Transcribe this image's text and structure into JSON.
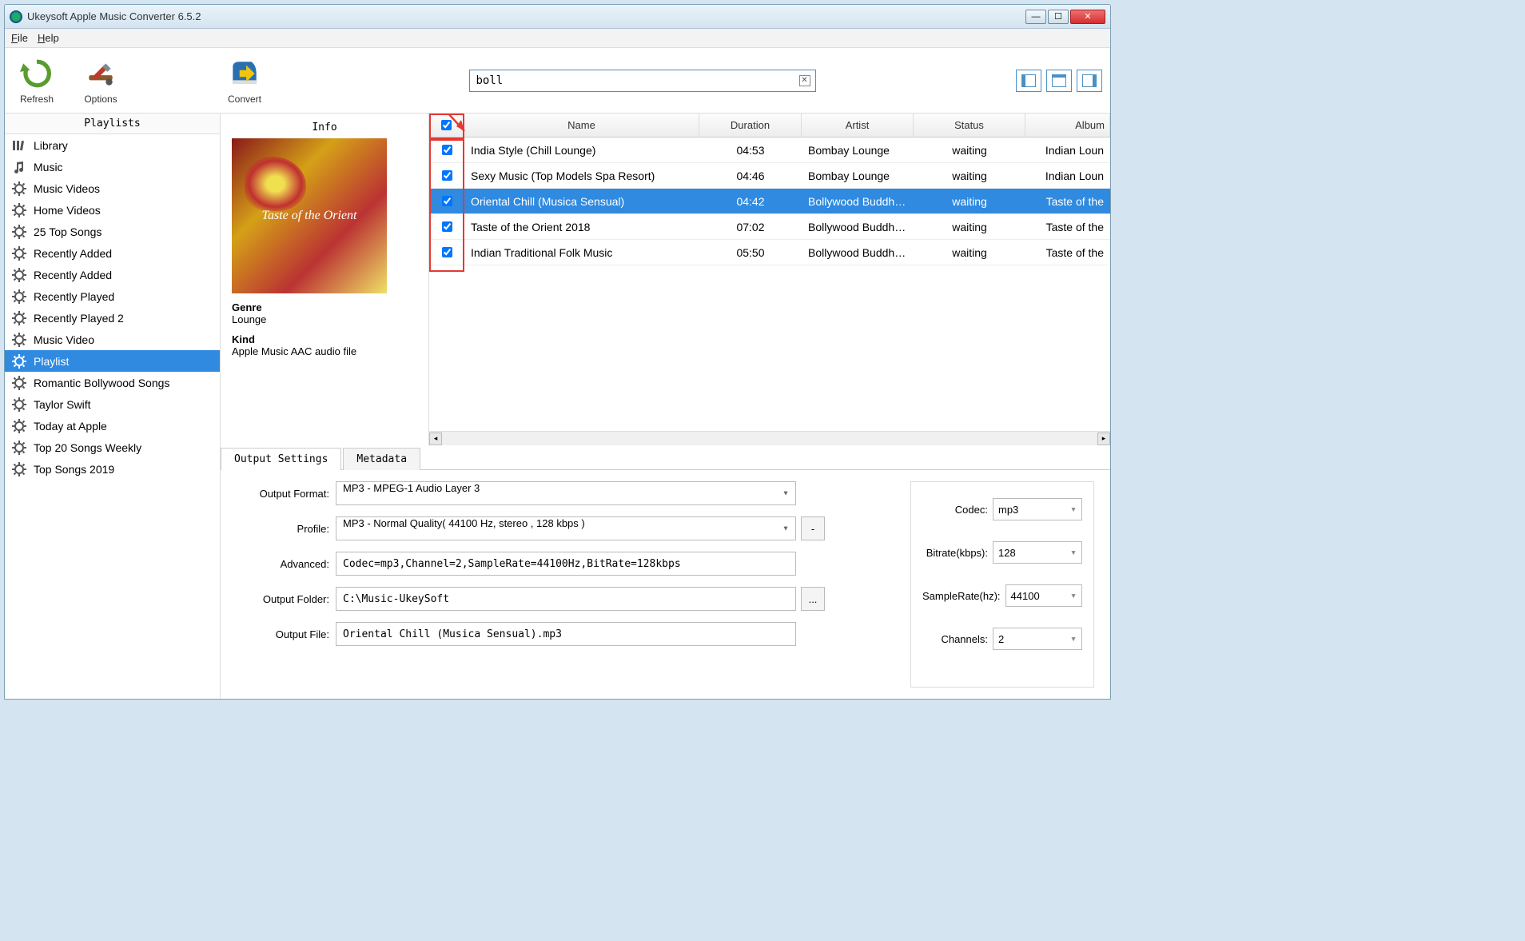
{
  "window": {
    "title": "Ukeysoft Apple Music Converter 6.5.2"
  },
  "menu": {
    "file": "File",
    "help": "Help"
  },
  "toolbar": {
    "refresh": "Refresh",
    "options": "Options",
    "convert": "Convert"
  },
  "search": {
    "value": "boll"
  },
  "sidebar": {
    "header": "Playlists",
    "items": [
      {
        "icon": "library",
        "label": "Library"
      },
      {
        "icon": "music",
        "label": "Music"
      },
      {
        "icon": "gear",
        "label": "Music Videos"
      },
      {
        "icon": "gear",
        "label": "Home Videos"
      },
      {
        "icon": "gear",
        "label": "25 Top Songs"
      },
      {
        "icon": "gear",
        "label": "Recently Added"
      },
      {
        "icon": "gear",
        "label": "Recently Added"
      },
      {
        "icon": "gear",
        "label": "Recently Played"
      },
      {
        "icon": "gear",
        "label": "Recently Played 2"
      },
      {
        "icon": "gear",
        "label": "Music Video"
      },
      {
        "icon": "gear",
        "label": "Playlist",
        "selected": true
      },
      {
        "icon": "gear",
        "label": "Romantic Bollywood Songs"
      },
      {
        "icon": "gear",
        "label": "Taylor Swift"
      },
      {
        "icon": "gear",
        "label": "Today at Apple"
      },
      {
        "icon": "gear",
        "label": "Top 20 Songs Weekly"
      },
      {
        "icon": "gear",
        "label": "Top Songs 2019"
      }
    ]
  },
  "info": {
    "header": "Info",
    "album_art_text": "Taste of the Orient",
    "genre_label": "Genre",
    "genre": "Lounge",
    "kind_label": "Kind",
    "kind": "Apple Music AAC audio file"
  },
  "table": {
    "columns": {
      "name": "Name",
      "duration": "Duration",
      "artist": "Artist",
      "status": "Status",
      "album": "Album"
    },
    "rows": [
      {
        "checked": true,
        "name": "India Style (Chill Lounge)",
        "duration": "04:53",
        "artist": "Bombay Lounge",
        "status": "waiting",
        "album": "Indian Loun"
      },
      {
        "checked": true,
        "name": "Sexy Music (Top Models Spa Resort)",
        "duration": "04:46",
        "artist": "Bombay Lounge",
        "status": "waiting",
        "album": "Indian Loun"
      },
      {
        "checked": true,
        "name": "Oriental Chill (Musica Sensual)",
        "duration": "04:42",
        "artist": "Bollywood Buddha...",
        "status": "waiting",
        "album": "Taste of the",
        "selected": true
      },
      {
        "checked": true,
        "name": "Taste of the Orient 2018",
        "duration": "07:02",
        "artist": "Bollywood Buddha...",
        "status": "waiting",
        "album": "Taste of the"
      },
      {
        "checked": true,
        "name": "Indian Traditional Folk Music",
        "duration": "05:50",
        "artist": "Bollywood Buddha...",
        "status": "waiting",
        "album": "Taste of the"
      }
    ]
  },
  "tabs": {
    "output": "Output Settings",
    "metadata": "Metadata"
  },
  "settings": {
    "output_format_label": "Output Format:",
    "output_format": "MP3 - MPEG-1 Audio Layer 3",
    "profile_label": "Profile:",
    "profile": "MP3 - Normal Quality( 44100 Hz, stereo , 128 kbps )",
    "profile_btn": "-",
    "advanced_label": "Advanced:",
    "advanced": "Codec=mp3,Channel=2,SampleRate=44100Hz,BitRate=128kbps",
    "folder_label": "Output Folder:",
    "folder": "C:\\Music-UkeySoft",
    "folder_btn": "...",
    "file_label": "Output File:",
    "file": "Oriental Chill (Musica Sensual).mp3",
    "codec_label": "Codec:",
    "codec": "mp3",
    "bitrate_label": "Bitrate(kbps):",
    "bitrate": "128",
    "samplerate_label": "SampleRate(hz):",
    "samplerate": "44100",
    "channels_label": "Channels:",
    "channels": "2"
  }
}
